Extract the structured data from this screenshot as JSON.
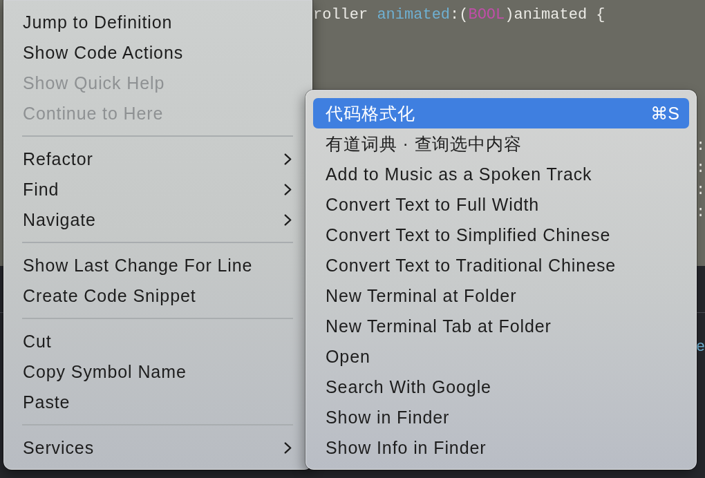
{
  "editor": {
    "top_pane": {
      "code_line": [
        {
          "text": "roller ",
          "kind": "plain"
        },
        {
          "text": "animated",
          "kind": "param"
        },
        {
          "text": ":(",
          "kind": "plain"
        },
        {
          "text": "BOOL",
          "kind": "keyword"
        },
        {
          "text": ")animated {",
          "kind": "plain"
        }
      ],
      "edge_fragments": [
        {
          "text": ":",
          "kind": "plain"
        },
        {
          "text": ":",
          "kind": "plain"
        },
        {
          "text": ":",
          "kind": "plain"
        },
        {
          "text": ":",
          "kind": "plain"
        }
      ]
    },
    "bottom_pane": {
      "edge_fragments": [
        {
          "text": "e",
          "kind": "param"
        }
      ]
    }
  },
  "context_menu": {
    "sections": [
      {
        "items": [
          {
            "label": "Jump to Definition",
            "disabled": false,
            "submenu": false
          },
          {
            "label": "Show Code Actions",
            "disabled": false,
            "submenu": false
          },
          {
            "label": "Show Quick Help",
            "disabled": true,
            "submenu": false
          },
          {
            "label": "Continue to Here",
            "disabled": true,
            "submenu": false
          }
        ]
      },
      {
        "items": [
          {
            "label": "Refactor",
            "disabled": false,
            "submenu": true
          },
          {
            "label": "Find",
            "disabled": false,
            "submenu": true
          },
          {
            "label": "Navigate",
            "disabled": false,
            "submenu": true
          }
        ]
      },
      {
        "items": [
          {
            "label": "Show Last Change For Line",
            "disabled": false,
            "submenu": false
          },
          {
            "label": "Create Code Snippet",
            "disabled": false,
            "submenu": false
          }
        ]
      },
      {
        "items": [
          {
            "label": "Cut",
            "disabled": false,
            "submenu": false
          },
          {
            "label": "Copy Symbol Name",
            "disabled": false,
            "submenu": false
          },
          {
            "label": "Paste",
            "disabled": false,
            "submenu": false
          }
        ]
      },
      {
        "items": [
          {
            "label": "Services",
            "disabled": false,
            "submenu": true
          }
        ]
      }
    ]
  },
  "services_submenu": {
    "items": [
      {
        "label": "代码格式化",
        "selected": true,
        "shortcut": "⌘S"
      },
      {
        "label": "有道词典 · 查询选中内容",
        "selected": false
      },
      {
        "label": "Add to Music as a Spoken Track",
        "selected": false
      },
      {
        "label": "Convert Text to Full Width",
        "selected": false
      },
      {
        "label": "Convert Text to Simplified Chinese",
        "selected": false
      },
      {
        "label": "Convert Text to Traditional Chinese",
        "selected": false
      },
      {
        "label": "New Terminal at Folder",
        "selected": false
      },
      {
        "label": "New Terminal Tab at Folder",
        "selected": false
      },
      {
        "label": "Open",
        "selected": false
      },
      {
        "label": "Search With Google",
        "selected": false
      },
      {
        "label": "Show in Finder",
        "selected": false
      },
      {
        "label": "Show Info in Finder",
        "selected": false
      }
    ]
  }
}
